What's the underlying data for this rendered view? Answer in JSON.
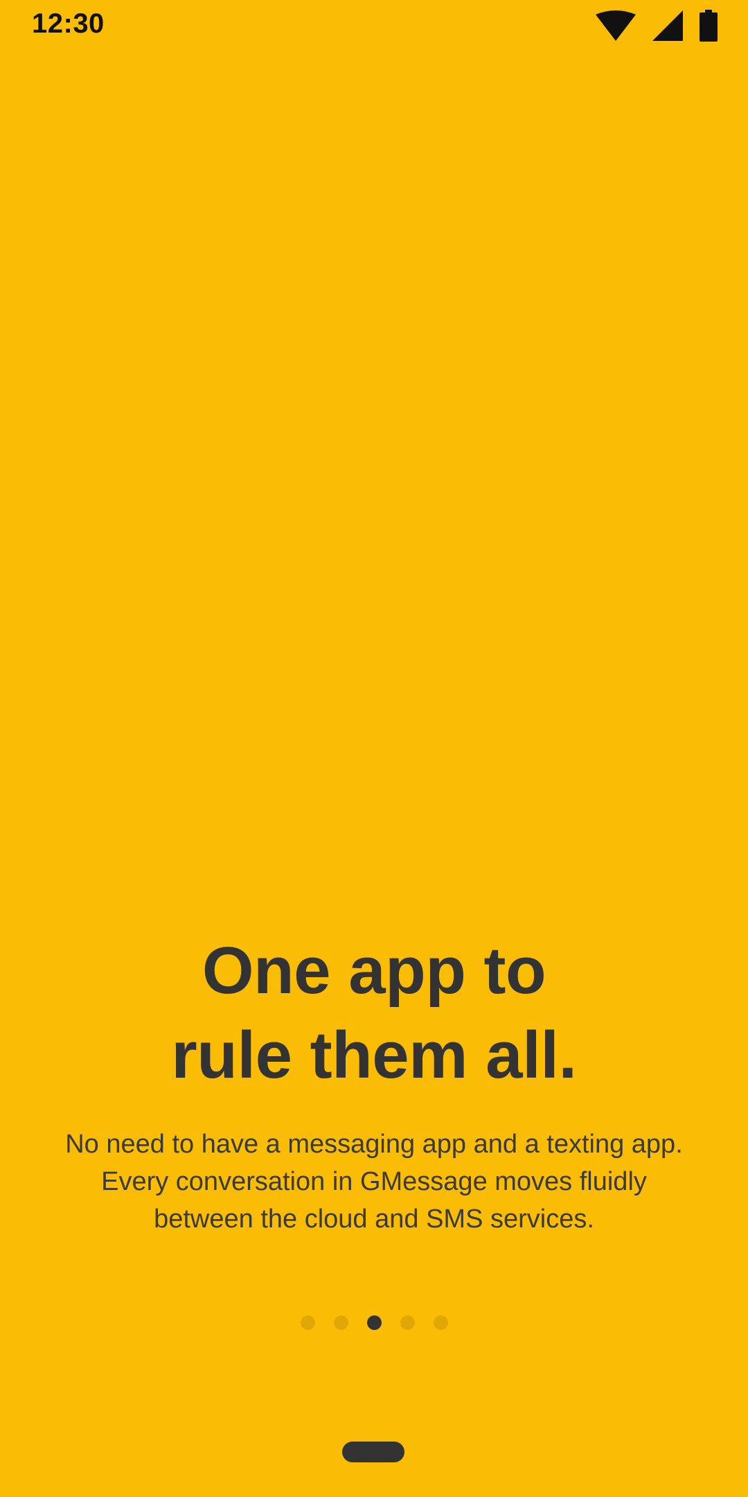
{
  "status_bar": {
    "time": "12:30",
    "icons": [
      "wifi-icon",
      "cell-signal-icon",
      "battery-icon"
    ]
  },
  "onboarding": {
    "headline_line1": "One app to",
    "headline_line2": "rule them all.",
    "body": "No need to have a messaging app and a texting app. Every conversation in GMessage moves fluidly between the cloud and SMS services.",
    "pager": {
      "total_pages": 5,
      "current_page": 3
    }
  },
  "colors": {
    "background": "#FBBC05",
    "text": "#333333",
    "dot_inactive": "rgba(0,0,0,0.10)",
    "dot_active": "#333333"
  }
}
